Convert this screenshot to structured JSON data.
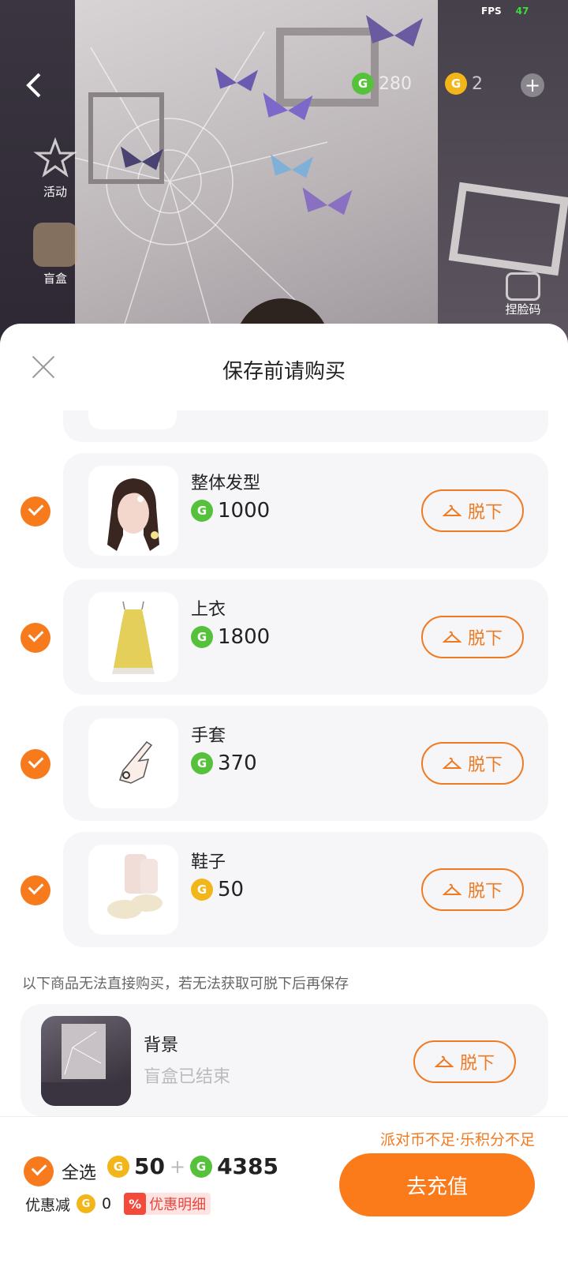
{
  "status": {
    "fps_label": "FPS",
    "fps_value": "47"
  },
  "top_bar": {
    "green_coin_amount": "280",
    "gold_coin_amount": "2"
  },
  "side_menu": {
    "activity_label": "活动",
    "blindbox_label": "盲盒",
    "capture_label": "捏脸码"
  },
  "sheet": {
    "title": "保存前请购买",
    "items": [
      {
        "name": "整体发型",
        "currency": "green",
        "price": "1000",
        "action": "脱下"
      },
      {
        "name": "上衣",
        "currency": "green",
        "price": "1800",
        "action": "脱下"
      },
      {
        "name": "手套",
        "currency": "green",
        "price": "370",
        "action": "脱下"
      },
      {
        "name": "鞋子",
        "currency": "gold",
        "price": "50",
        "action": "脱下"
      }
    ],
    "note": "以下商品无法直接购买，若无法获取可脱下后再保存",
    "unavailable": {
      "name": "背景",
      "status": "盲盒已结束",
      "action": "脱下"
    }
  },
  "footer": {
    "warning": "派对币不足·乐积分不足",
    "select_all": "全选",
    "gold_total": "50",
    "plus": "+",
    "green_total": "4385",
    "discount_label": "优惠减",
    "discount_value": "0",
    "discount_badge": "%",
    "discount_detail": "优惠明细",
    "recharge": "去充值"
  },
  "colors": {
    "accent": "#f77a1c",
    "green_coin": "#56c23c",
    "gold_coin": "#f3b61a"
  },
  "icons": {
    "coin_green": "G",
    "coin_gold": "G"
  }
}
